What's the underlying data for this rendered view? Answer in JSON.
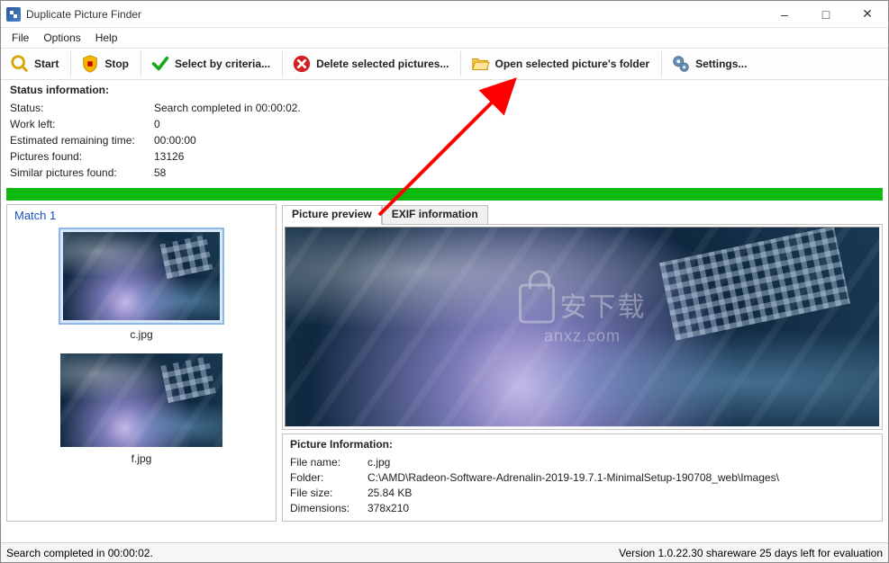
{
  "window": {
    "title": "Duplicate Picture Finder"
  },
  "menu": {
    "file": "File",
    "options": "Options",
    "help": "Help"
  },
  "toolbar": {
    "start": "Start",
    "stop": "Stop",
    "select_by_criteria": "Select by criteria...",
    "delete_selected": "Delete selected pictures...",
    "open_folder": "Open selected picture's folder",
    "settings": "Settings..."
  },
  "status_info": {
    "heading": "Status information:",
    "rows": {
      "status": {
        "label": "Status:",
        "value": "Search completed in 00:00:02."
      },
      "work_left": {
        "label": "Work left:",
        "value": "0"
      },
      "eta": {
        "label": "Estimated remaining time:",
        "value": "00:00:00"
      },
      "pictures_found": {
        "label": "Pictures found:",
        "value": "13126"
      },
      "similar_found": {
        "label": "Similar pictures found:",
        "value": "58"
      }
    }
  },
  "match": {
    "header": "Match 1",
    "thumbs": [
      {
        "caption": "c.jpg",
        "selected": true
      },
      {
        "caption": "f.jpg",
        "selected": false
      }
    ]
  },
  "tabs": {
    "preview": "Picture preview",
    "exif": "EXIF information"
  },
  "picture_info": {
    "heading": "Picture Information:",
    "file_name": {
      "label": "File name:",
      "value": "c.jpg"
    },
    "folder": {
      "label": "Folder:",
      "value": "C:\\AMD\\Radeon-Software-Adrenalin-2019-19.7.1-MinimalSetup-190708_web\\Images\\"
    },
    "file_size": {
      "label": "File size:",
      "value": "25.84 KB"
    },
    "dimensions": {
      "label": "Dimensions:",
      "value": "378x210"
    }
  },
  "statusbar": {
    "left": "Search completed in 00:00:02.",
    "right": "Version 1.0.22.30 shareware 25 days left for evaluation"
  },
  "watermark": {
    "line1": "安下载",
    "line2": "anxz.com"
  }
}
